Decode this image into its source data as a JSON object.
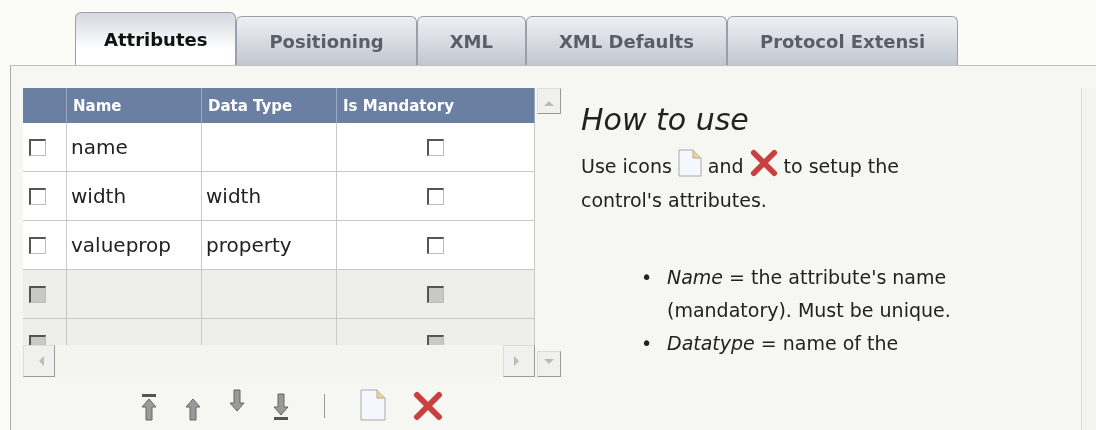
{
  "tabs": [
    {
      "label": "Attributes",
      "selected": true
    },
    {
      "label": "Positioning",
      "selected": false
    },
    {
      "label": "XML",
      "selected": false
    },
    {
      "label": "XML Defaults",
      "selected": false
    },
    {
      "label": "Protocol Extensi",
      "selected": false
    }
  ],
  "table": {
    "columns": [
      "Name",
      "Data Type",
      "Is Mandatory"
    ],
    "rows": [
      {
        "name": "name",
        "data_type": "",
        "checked": false,
        "mandatory": false,
        "disabled": false
      },
      {
        "name": "width",
        "data_type": "width",
        "checked": false,
        "mandatory": false,
        "disabled": false
      },
      {
        "name": "valueprop",
        "data_type": "property",
        "checked": false,
        "mandatory": false,
        "disabled": false
      },
      {
        "name": "",
        "data_type": "",
        "checked": false,
        "mandatory": false,
        "disabled": true
      },
      {
        "name": "",
        "data_type": "",
        "checked": false,
        "mandatory": false,
        "disabled": true
      }
    ]
  },
  "toolbar": [
    {
      "kind": "top"
    },
    {
      "kind": "up"
    },
    {
      "kind": "down"
    },
    {
      "kind": "bottom"
    },
    {
      "kind": "separator"
    },
    {
      "kind": "new"
    },
    {
      "kind": "delete"
    }
  ],
  "help": {
    "title": "How to use",
    "intro": [
      "Use icons",
      "and",
      "to setup the",
      "control's attributes."
    ],
    "bullets": [
      {
        "marker": "•",
        "text": "*Name* = the attribute's name (mandatory). Must be unique."
      },
      {
        "marker": "•",
        "text": "*Datatype* = name of the"
      }
    ]
  }
}
